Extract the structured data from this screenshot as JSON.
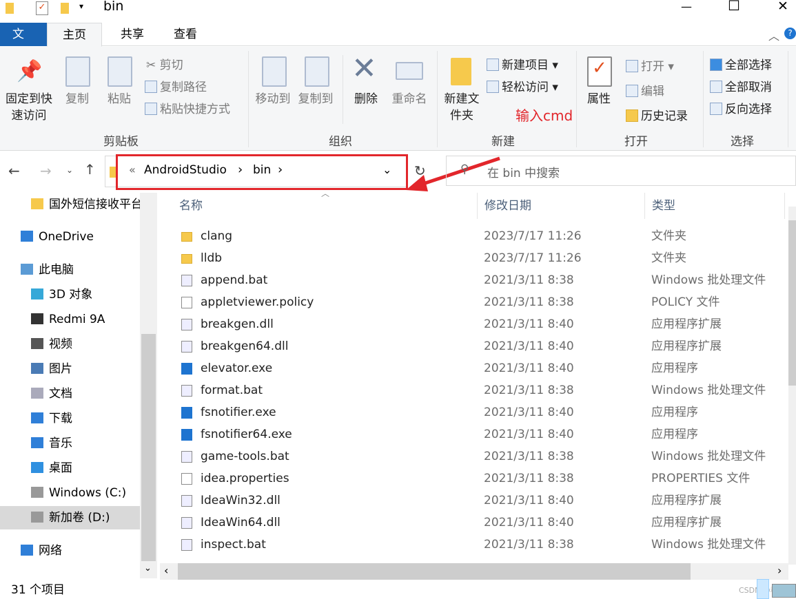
{
  "window": {
    "title": "bin",
    "minimize": "—",
    "maximize": "☐",
    "close": "✕"
  },
  "ribbon_tabs": [
    "文件",
    "主页",
    "共享",
    "查看"
  ],
  "ribbon": {
    "pin": "固定到快速访问",
    "copy": "复制",
    "paste": "粘贴",
    "cut": "剪切",
    "copy_path": "复制路径",
    "paste_shortcut": "粘贴快捷方式",
    "clipboard": "剪贴板",
    "move_to": "移动到",
    "copy_to": "复制到",
    "delete": "删除",
    "rename": "重命名",
    "organize": "组织",
    "new_folder": "新建文件夹",
    "new_item": "新建项目 ▾",
    "easy_access": "轻松访问 ▾",
    "new": "新建",
    "properties": "属性",
    "open": "打开 ▾",
    "edit": "编辑",
    "history": "历史记录",
    "open_group": "打开",
    "select_all": "全部选择",
    "select_none": "全部取消",
    "invert": "反向选择",
    "select": "选择"
  },
  "annotation": {
    "text": "输入cmd",
    "color": "#e2262b"
  },
  "address": {
    "prefix": "«",
    "crumbs": [
      "AndroidStudio",
      "bin"
    ],
    "sep": "›"
  },
  "search": {
    "placeholder": "在 bin 中搜索"
  },
  "nav": [
    {
      "label": "国外短信接收平台",
      "icon": "folder-icon"
    },
    {
      "label": "OneDrive",
      "icon": "cloud-icon"
    },
    {
      "label": "此电脑",
      "icon": "computer-icon"
    },
    {
      "label": "3D 对象",
      "icon": "cube-icon"
    },
    {
      "label": "Redmi 9A",
      "icon": "phone-icon"
    },
    {
      "label": "视频",
      "icon": "video-icon"
    },
    {
      "label": "图片",
      "icon": "picture-icon"
    },
    {
      "label": "文档",
      "icon": "document-icon"
    },
    {
      "label": "下载",
      "icon": "download-icon"
    },
    {
      "label": "音乐",
      "icon": "music-icon"
    },
    {
      "label": "桌面",
      "icon": "desktop-icon"
    },
    {
      "label": "Windows (C:)",
      "icon": "drive-icon"
    },
    {
      "label": "新加卷 (D:)",
      "icon": "drive-icon",
      "selected": true
    },
    {
      "label": "网络",
      "icon": "network-icon"
    }
  ],
  "columns": [
    "名称",
    "修改日期",
    "类型"
  ],
  "files": [
    {
      "name": "clang",
      "date": "2023/7/17 11:26",
      "type": "文件夹",
      "kind": "folder"
    },
    {
      "name": "lldb",
      "date": "2023/7/17 11:26",
      "type": "文件夹",
      "kind": "folder"
    },
    {
      "name": "append.bat",
      "date": "2021/3/11 8:38",
      "type": "Windows 批处理文件",
      "kind": "bat"
    },
    {
      "name": "appletviewer.policy",
      "date": "2021/3/11 8:38",
      "type": "POLICY 文件",
      "kind": "file"
    },
    {
      "name": "breakgen.dll",
      "date": "2021/3/11 8:40",
      "type": "应用程序扩展",
      "kind": "dll"
    },
    {
      "name": "breakgen64.dll",
      "date": "2021/3/11 8:40",
      "type": "应用程序扩展",
      "kind": "dll"
    },
    {
      "name": "elevator.exe",
      "date": "2021/3/11 8:40",
      "type": "应用程序",
      "kind": "exe"
    },
    {
      "name": "format.bat",
      "date": "2021/3/11 8:38",
      "type": "Windows 批处理文件",
      "kind": "bat"
    },
    {
      "name": "fsnotifier.exe",
      "date": "2021/3/11 8:40",
      "type": "应用程序",
      "kind": "exe"
    },
    {
      "name": "fsnotifier64.exe",
      "date": "2021/3/11 8:40",
      "type": "应用程序",
      "kind": "exe"
    },
    {
      "name": "game-tools.bat",
      "date": "2021/3/11 8:38",
      "type": "Windows 批处理文件",
      "kind": "bat"
    },
    {
      "name": "idea.properties",
      "date": "2021/3/11 8:38",
      "type": "PROPERTIES 文件",
      "kind": "file"
    },
    {
      "name": "IdeaWin32.dll",
      "date": "2021/3/11 8:40",
      "type": "应用程序扩展",
      "kind": "dll"
    },
    {
      "name": "IdeaWin64.dll",
      "date": "2021/3/11 8:40",
      "type": "应用程序扩展",
      "kind": "dll"
    },
    {
      "name": "inspect.bat",
      "date": "2021/3/11 8:38",
      "type": "Windows 批处理文件",
      "kind": "bat"
    }
  ],
  "status": {
    "count": "31 个项目"
  },
  "watermark": "CSDN @程序"
}
